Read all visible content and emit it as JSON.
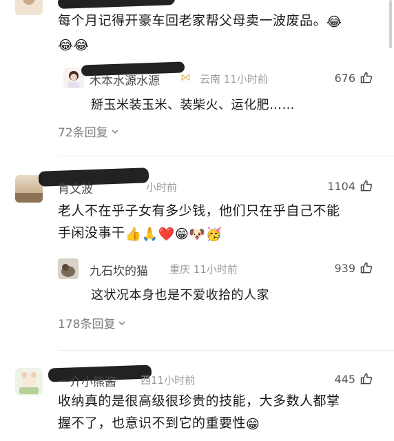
{
  "comments": [
    {
      "text": "每个月记得开豪车回老家帮父母卖一波废品。",
      "emoji_tail": "😂",
      "emoji_line2": "😂😂",
      "reply": {
        "name": "木本水源水源",
        "location": "云南",
        "time": "11小时前",
        "likes": "676",
        "text": "掰玉米装玉米、装柴火、运化肥……"
      },
      "more_label": "72条回复"
    },
    {
      "name": "肖文波",
      "time": "小时前",
      "likes": "1104",
      "text_line1": "老人不在乎子女有多少钱，他们只在乎自己不能",
      "text_line2": "手闲没事干",
      "emojis": "👍🙏❤️😁🐶🥳",
      "reply": {
        "name": "九石坎的猫",
        "location": "重庆",
        "time": "11小时前",
        "likes": "939",
        "text": "这状况本身也是不爱收拾的人家"
      },
      "more_label": "178条回复"
    },
    {
      "name": "一介小熊酱",
      "location": "西",
      "time": "11小时前",
      "likes": "445",
      "text_line1": "收纳真的是很高级很珍贵的技能，大多数人都掌",
      "text_line2": "握不了，也意识不到它的重要性",
      "emoji_tail": "😁"
    }
  ],
  "colors": {
    "name": "#4a4a4a",
    "meta": "#9a9a9a",
    "text": "#1a1a1a",
    "more": "#7d7d7d"
  }
}
